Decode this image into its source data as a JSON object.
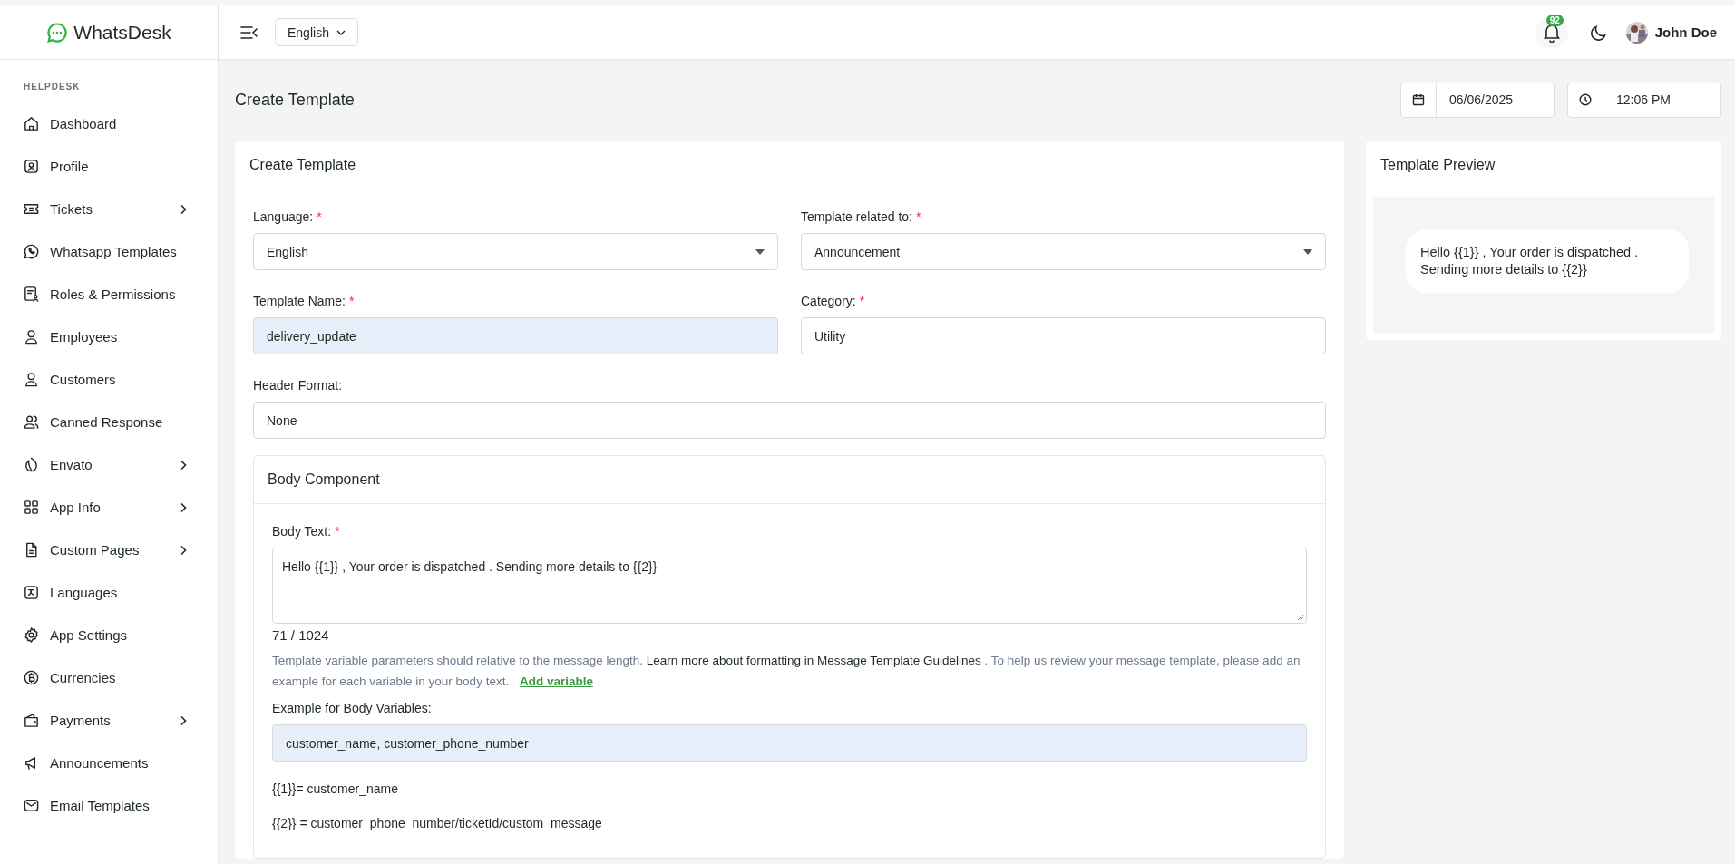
{
  "brand": {
    "name": "WhatsDesk"
  },
  "sidebar": {
    "section": "HELPDESK",
    "items": [
      {
        "label": "Dashboard",
        "has_children": false
      },
      {
        "label": "Profile",
        "has_children": false
      },
      {
        "label": "Tickets",
        "has_children": true
      },
      {
        "label": "Whatsapp Templates",
        "has_children": false
      },
      {
        "label": "Roles & Permissions",
        "has_children": false
      },
      {
        "label": "Employees",
        "has_children": false
      },
      {
        "label": "Customers",
        "has_children": false
      },
      {
        "label": "Canned Response",
        "has_children": false
      },
      {
        "label": "Envato",
        "has_children": true
      },
      {
        "label": "App Info",
        "has_children": true
      },
      {
        "label": "Custom Pages",
        "has_children": true
      },
      {
        "label": "Languages",
        "has_children": false
      },
      {
        "label": "App Settings",
        "has_children": false
      },
      {
        "label": "Currencies",
        "has_children": false
      },
      {
        "label": "Payments",
        "has_children": true
      },
      {
        "label": "Announcements",
        "has_children": false
      },
      {
        "label": "Email Templates",
        "has_children": false
      }
    ]
  },
  "topbar": {
    "language": "English",
    "notifications": "92",
    "user": "John Doe"
  },
  "page": {
    "title": "Create Template",
    "date": "06/06/2025",
    "time": "12:06 PM"
  },
  "form": {
    "title": "Create Template",
    "fields": [
      {
        "label": "Language:",
        "required_mark": "*",
        "value": "English",
        "kind": "select",
        "filled": false
      },
      {
        "label": "Template related to:",
        "required_mark": "*",
        "value": "Announcement",
        "kind": "select",
        "filled": false
      },
      {
        "label": "Template Name:",
        "required_mark": "*",
        "value": "delivery_update",
        "kind": "text",
        "filled": true
      },
      {
        "label": "Category:",
        "required_mark": "*",
        "value": "Utility",
        "kind": "text",
        "filled": false
      },
      {
        "label": "Header Format:",
        "value": "None",
        "kind": "text",
        "filled": false
      }
    ],
    "body": {
      "title": "Body Component",
      "label": "Body Text:",
      "required_mark": "*",
      "value": "Hello {{1}} , Your order is dispatched . Sending more details to {{2}}",
      "count": "71 / 1024",
      "help_before": "Template variable parameters should relative to the message length.",
      "help_link": "Learn more about formatting in Message Template Guidelines",
      "help_after": ". To help us review your message template, please add an example for each variable in your body text.",
      "add_variable": "Add variable",
      "example_label": "Example for Body Variables:",
      "example_value": "customer_name, customer_phone_number",
      "mappings": [
        "{{1}}= customer_name",
        "{{2}} = customer_phone_number/ticketId/custom_message"
      ]
    }
  },
  "preview": {
    "title": "Template Preview",
    "lines": [
      "Hello {{1}} , Your order is dispatched .",
      "Sending more details to {{2}}"
    ]
  }
}
